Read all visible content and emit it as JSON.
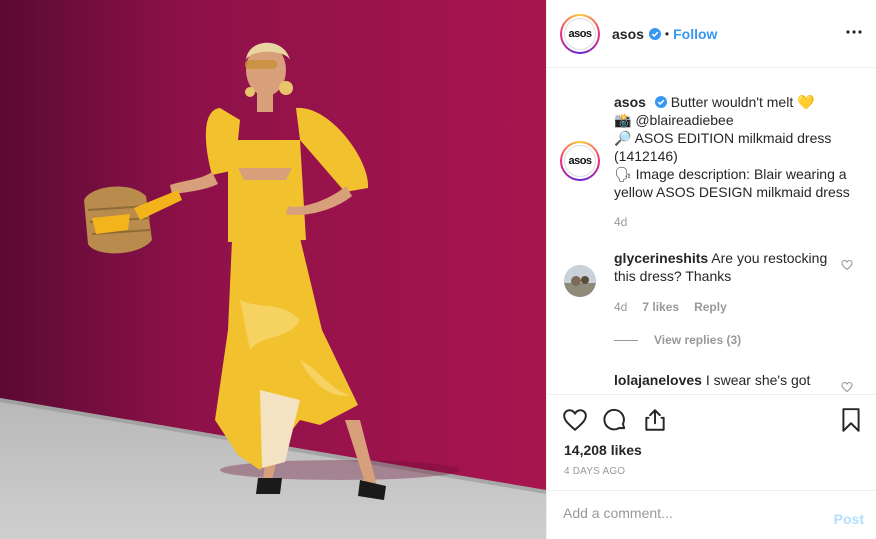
{
  "post": {
    "image_alt": "Blair wearing a yellow ASOS DESIGN milkmaid dress",
    "avatar_text": "asos",
    "username": "asos",
    "separator": "•",
    "follow_label": "Follow",
    "caption": {
      "username": "asos",
      "line1": "Butter wouldn't melt",
      "line1_emoji": "💛",
      "line2_emoji": "📸",
      "line2": "@blaireadiebee",
      "line3_emoji": "🔎",
      "line3": "ASOS EDITION milkmaid dress (1412146)",
      "line4_emoji": "🗣",
      "line4": "Image description: Blair wearing a yellow ASOS DESIGN milkmaid dress",
      "time": "4d"
    },
    "comments": [
      {
        "username": "glycerineshits",
        "text": "Are you restocking this dress? Thanks",
        "time": "4d",
        "likes": "7 likes",
        "reply": "Reply",
        "view_replies": "View replies (3)"
      },
      {
        "username": "lolajaneloves",
        "text": "I swear she's got"
      }
    ],
    "likes_count": "14,208 likes",
    "date": "4 DAYS AGO",
    "add_comment_placeholder": "Add a comment...",
    "post_label": "Post"
  },
  "colors": {
    "wall": "#a3124e",
    "dress": "#f2c12e",
    "follow": "#3897f0",
    "post_disabled": "#b2dffc",
    "verified": "#3897f0"
  },
  "icons": [
    "more-horizontal-icon",
    "verified-icon",
    "heart-icon",
    "comment-icon",
    "share-icon",
    "bookmark-icon"
  ]
}
